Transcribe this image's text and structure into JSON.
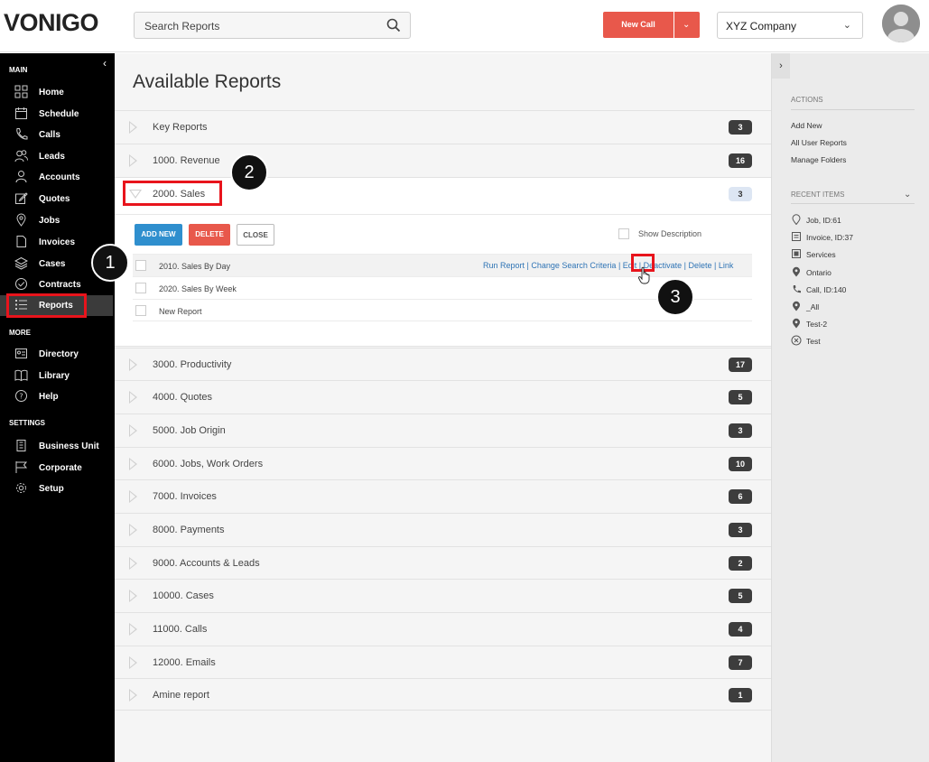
{
  "header": {
    "logo": "VONIGO",
    "search_placeholder": "Search Reports",
    "new_call_label": "New Call",
    "company": "XYZ Company"
  },
  "sidebar": {
    "section_main": "MAIN",
    "section_more": "MORE",
    "section_settings": "SETTINGS",
    "main_items": [
      {
        "label": "Home",
        "icon": "grid-icon"
      },
      {
        "label": "Schedule",
        "icon": "calendar-icon"
      },
      {
        "label": "Calls",
        "icon": "phone-icon"
      },
      {
        "label": "Leads",
        "icon": "people-icon"
      },
      {
        "label": "Accounts",
        "icon": "person-icon"
      },
      {
        "label": "Quotes",
        "icon": "edit-icon"
      },
      {
        "label": "Jobs",
        "icon": "pin-icon"
      },
      {
        "label": "Invoices",
        "icon": "document-icon"
      },
      {
        "label": "Cases",
        "icon": "layers-icon"
      },
      {
        "label": "Contracts",
        "icon": "check-circle-icon"
      },
      {
        "label": "Reports",
        "icon": "list-icon",
        "active": true
      }
    ],
    "more_items": [
      {
        "label": "Directory",
        "icon": "directory-icon"
      },
      {
        "label": "Library",
        "icon": "book-icon"
      },
      {
        "label": "Help",
        "icon": "help-icon"
      }
    ],
    "settings_items": [
      {
        "label": "Business Unit",
        "icon": "building-icon"
      },
      {
        "label": "Corporate",
        "icon": "flag-icon"
      },
      {
        "label": "Setup",
        "icon": "gear-icon"
      }
    ]
  },
  "main": {
    "title": "Available Reports",
    "groups_top": [
      {
        "name": "Key Reports",
        "count": "3"
      },
      {
        "name": "1000. Revenue",
        "count": "16"
      }
    ],
    "expanded": {
      "name": "2000. Sales",
      "count": "3",
      "add_new": "ADD NEW",
      "delete": "DELETE",
      "close": "CLOSE",
      "show_description": "Show Description",
      "reports": [
        {
          "name": "2010. Sales By Day"
        },
        {
          "name": "2020. Sales By Week"
        },
        {
          "name": "New Report"
        }
      ],
      "actions": {
        "run_report": "Run Report",
        "change_search_criteria": "Change Search Criteria",
        "edit": "Edit",
        "deactivate": "Deactivate",
        "delete": "Delete",
        "link": "Link",
        "separator": " | "
      }
    },
    "groups_bottom": [
      {
        "name": "3000. Productivity",
        "count": "17"
      },
      {
        "name": "4000. Quotes",
        "count": "5"
      },
      {
        "name": "5000. Job Origin",
        "count": "3"
      },
      {
        "name": "6000. Jobs, Work Orders",
        "count": "10"
      },
      {
        "name": "7000. Invoices",
        "count": "6"
      },
      {
        "name": "8000. Payments",
        "count": "3"
      },
      {
        "name": "9000. Accounts & Leads",
        "count": "2"
      },
      {
        "name": "10000. Cases",
        "count": "5"
      },
      {
        "name": "11000. Calls",
        "count": "4"
      },
      {
        "name": "12000. Emails",
        "count": "7"
      },
      {
        "name": "Amine report",
        "count": "1"
      }
    ]
  },
  "right_panel": {
    "actions_heading": "ACTIONS",
    "actions": [
      "Add New",
      "All User Reports",
      "Manage Folders"
    ],
    "recent_heading": "RECENT ITEMS",
    "recent": [
      {
        "label": "Job, ID:61",
        "icon": "pin-icon"
      },
      {
        "label": "Invoice, ID:37",
        "icon": "invoice-icon"
      },
      {
        "label": "Services",
        "icon": "services-icon"
      },
      {
        "label": "Ontario",
        "icon": "location-icon"
      },
      {
        "label": "Call, ID:140",
        "icon": "phone-icon"
      },
      {
        "label": "_All",
        "icon": "location-icon"
      },
      {
        "label": "Test-2",
        "icon": "location-icon"
      },
      {
        "label": "Test",
        "icon": "cancel-circle-icon"
      }
    ]
  },
  "annotations": [
    "1",
    "2",
    "3"
  ]
}
